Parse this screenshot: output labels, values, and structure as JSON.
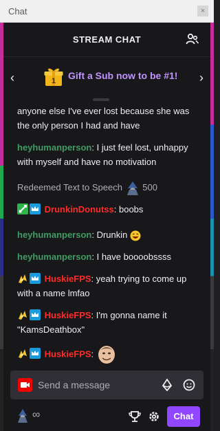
{
  "window": {
    "title": "Chat",
    "close_glyph": "×"
  },
  "header": {
    "title": "STREAM CHAT",
    "users_icon": "users-icon"
  },
  "banner": {
    "text": "Gift a Sub now to be #1!",
    "gift_number": "1",
    "prev": "‹",
    "next": "›"
  },
  "messages": [
    {
      "text": "anyone else I've ever lost because she was the only person I had and have"
    },
    {
      "user": "heyhumanperson",
      "sep": ": ",
      "text": "I just feel lost, unhappy with myself and have no motivation"
    },
    {
      "user": "DrunkinDonutss",
      "sep": ": ",
      "text": "boobs"
    },
    {
      "user": "heyhumanperson",
      "sep": ": ",
      "text": "Drunkin "
    },
    {
      "user": "heyhumanperson",
      "sep": ": ",
      "text": "I have boooobssss"
    },
    {
      "user": "HuskieFPS",
      "sep": ": ",
      "text": "yeah trying to come up with a name lmfao"
    },
    {
      "user": "HuskieFPS",
      "sep": ": ",
      "text": "I'm gonna name it \"KamsDeathbox\""
    },
    {
      "user": "HuskieFPS",
      "sep": ": ",
      "text": ""
    }
  ],
  "redeem": {
    "label": "Redeemed Text to Speech",
    "points": "500"
  },
  "input": {
    "placeholder": "Send a message"
  },
  "footer": {
    "infinity": "∞",
    "chat_button": "Chat"
  },
  "colors": {
    "accent": "#9147ff",
    "green_user": "#3f9c63",
    "red_user": "#ff2a2a",
    "banner_text": "#bf94ff"
  }
}
